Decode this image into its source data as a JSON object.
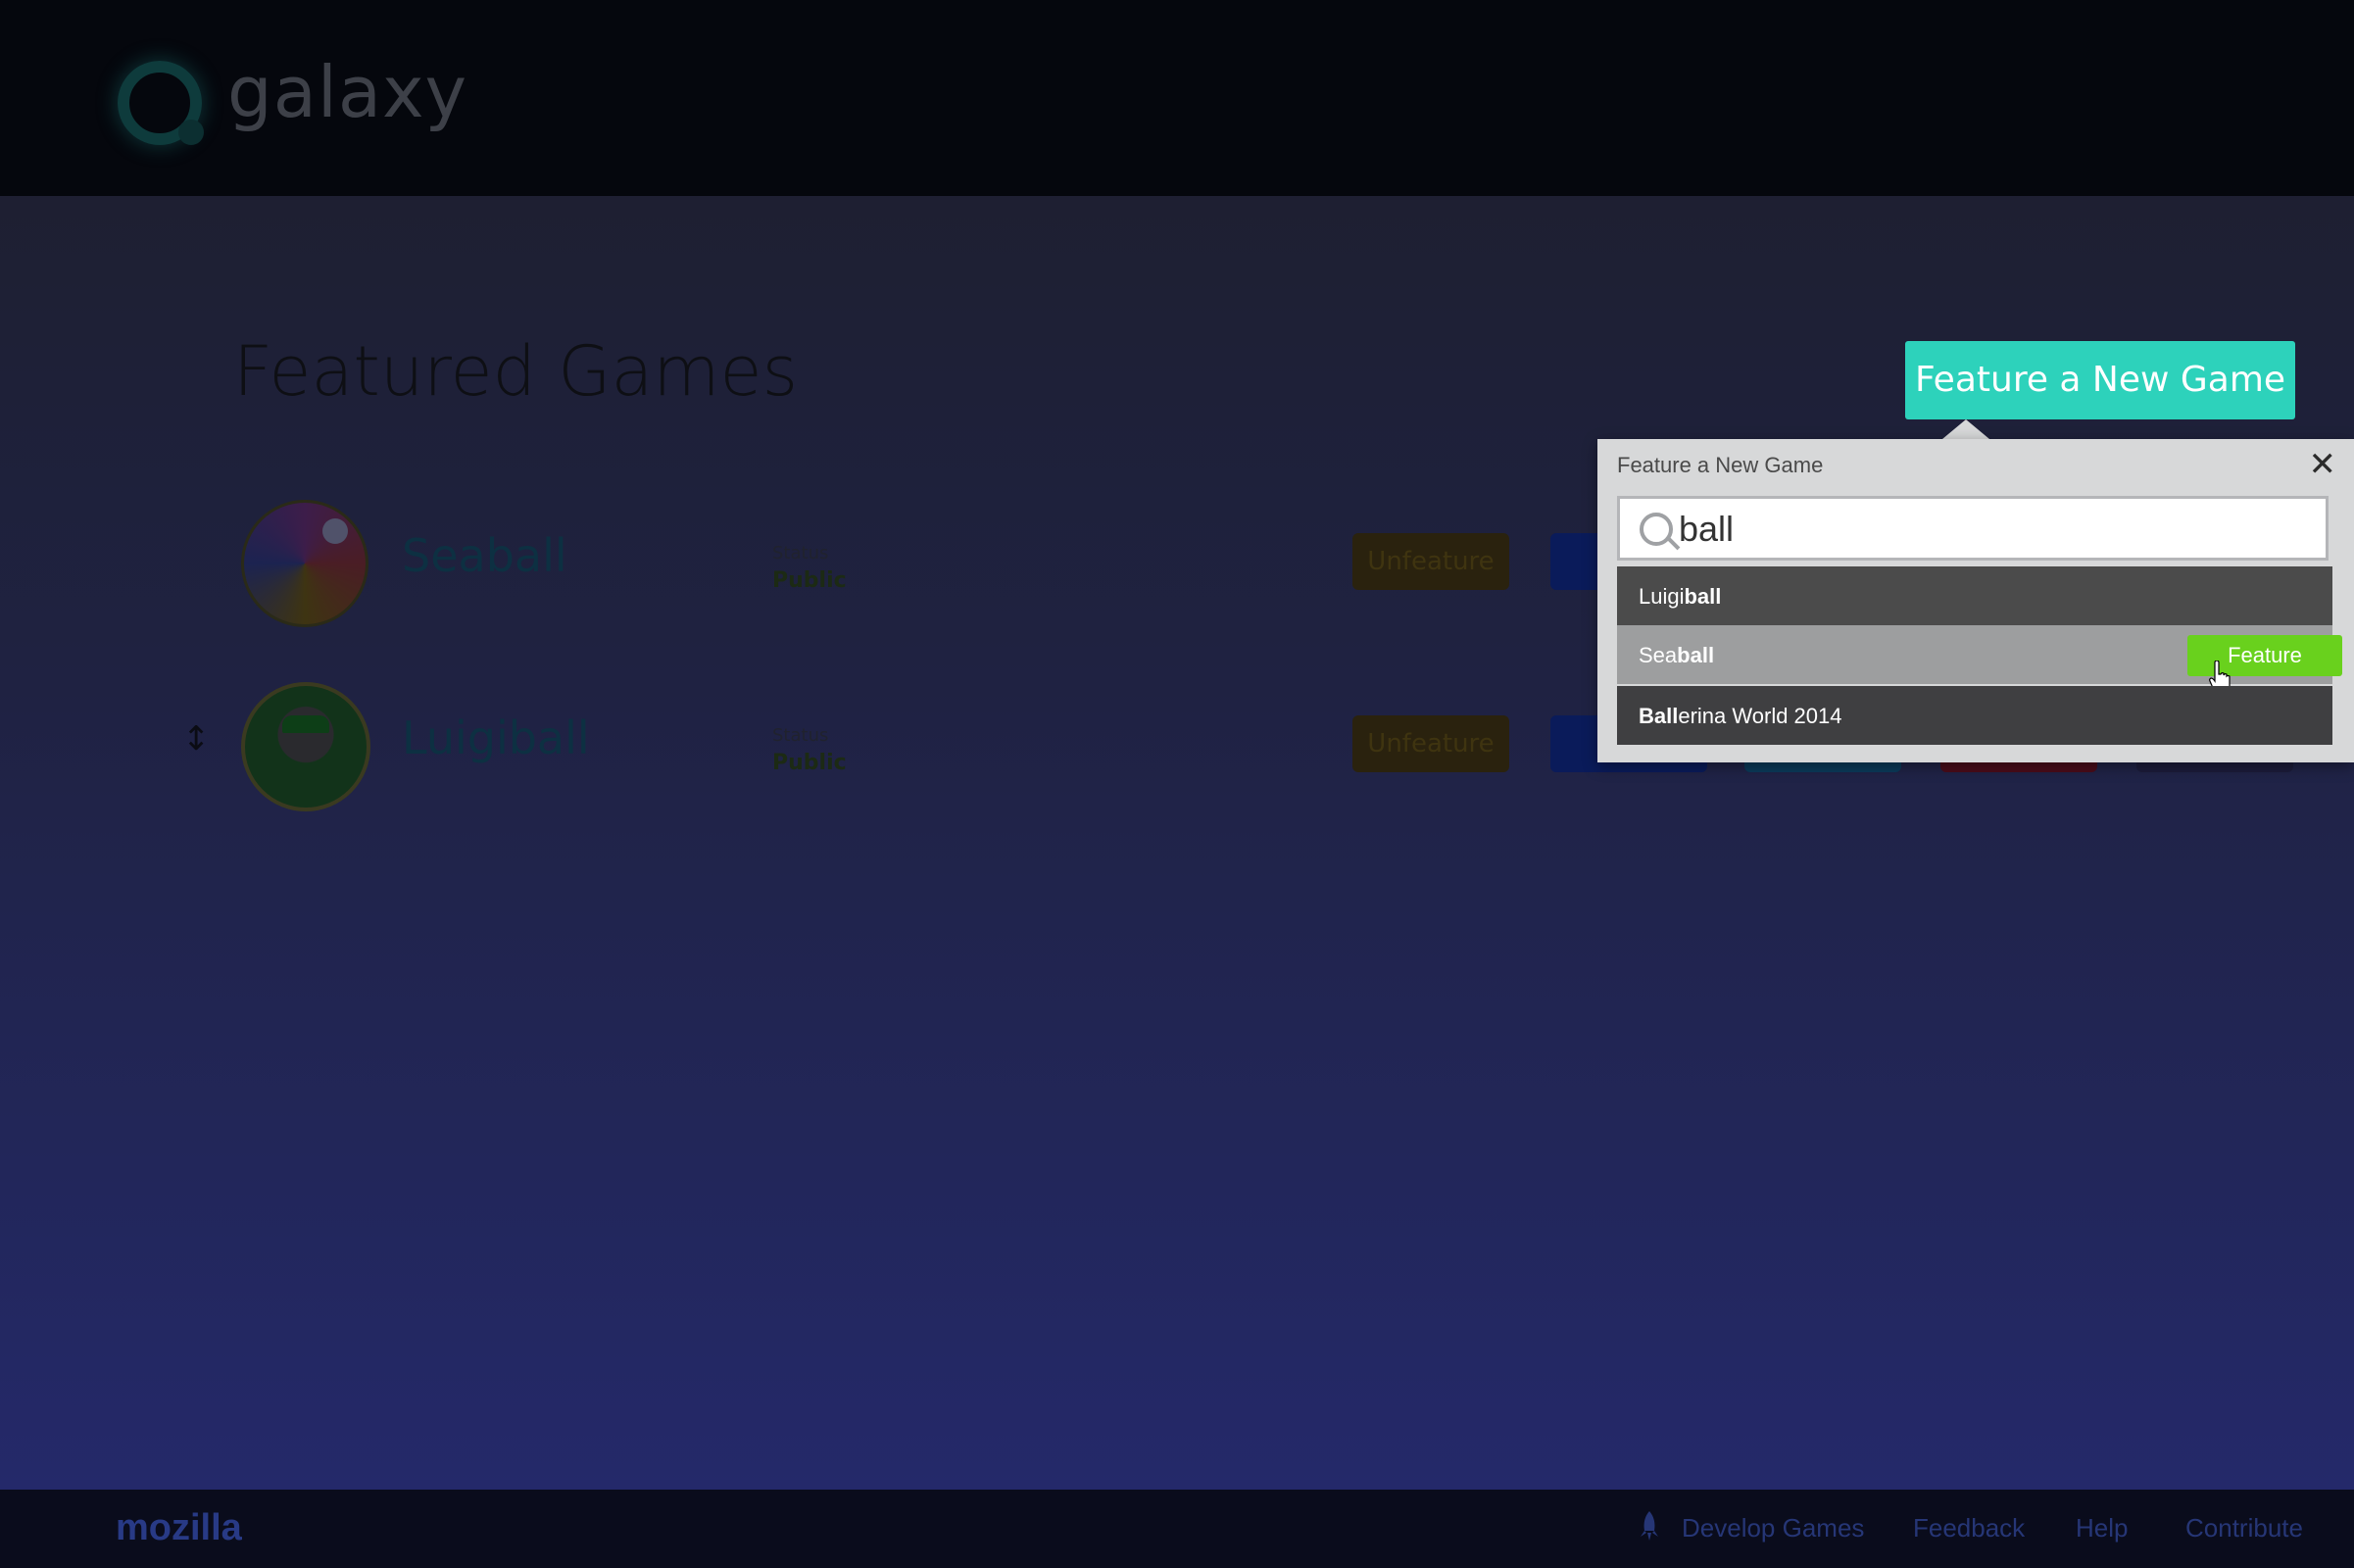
{
  "header": {
    "brand": "galaxy"
  },
  "page": {
    "title": "Featured Games",
    "feature_new_button": "Feature a New Game"
  },
  "games": [
    {
      "name": "Seaball",
      "status_label": "Status",
      "status_value": "Public",
      "unfeature_label": "Unfeature"
    },
    {
      "name": "Luigiball",
      "status_label": "Status",
      "status_value": "Public",
      "unfeature_label": "Unfeature"
    }
  ],
  "popover": {
    "title": "Feature a New Game",
    "search_value": "ball",
    "results": [
      {
        "prefix": "Luigi",
        "match": "ball",
        "suffix": ""
      },
      {
        "prefix": "Sea",
        "match": "ball",
        "suffix": "",
        "action": "Feature"
      },
      {
        "prefix": "",
        "match": "Ball",
        "suffix": "erina World 2014"
      }
    ]
  },
  "footer": {
    "logo": "mozilla",
    "links": [
      "Develop Games",
      "Feedback",
      "Help",
      "Contribute"
    ]
  },
  "colors": {
    "accent_teal": "#2dd2bb",
    "feature_green": "#69d11d"
  }
}
